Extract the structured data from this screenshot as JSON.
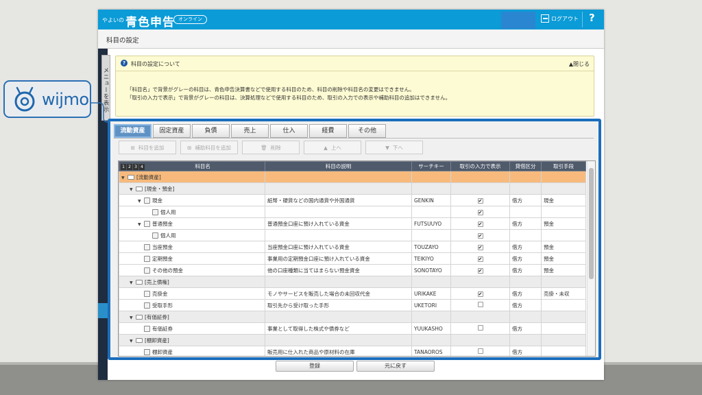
{
  "header": {
    "brand_small": "やよいの",
    "brand": "青色申告",
    "online_badge": "オンライン",
    "logout": "ログアウト",
    "help": "?"
  },
  "page_title": "科目の設定",
  "menu_tab": "メニューを表示",
  "info": {
    "title": "科目の設定について",
    "close": "▲閉じる",
    "line1": "「科目名」で背景がグレーの科目は、青色申告決算書などで使用する科目のため、科目の削除や科目名の変更はできません。",
    "line2": "「取引の入力で表示」で背景がグレーの科目は、決算処理などで使用する科目のため、取引の入力での表示や補助科目の追加はできません。"
  },
  "tabs": [
    "流動資産",
    "固定資産",
    "負債",
    "売上",
    "仕入",
    "経費",
    "その他"
  ],
  "toolbar": {
    "add_account": "科目を追加",
    "add_sub_account": "補助科目を追加",
    "delete": "削除",
    "up": "上へ",
    "down": "下へ"
  },
  "grid": {
    "levels": [
      "1",
      "2",
      "3",
      "4"
    ],
    "columns": {
      "name": "科目名",
      "description": "科目の説明",
      "search_key": "サーチキー",
      "show_in_entry": "取引の入力で表示",
      "debit_credit": "貸借区分",
      "method": "取引手段"
    },
    "rows": [
      {
        "level": 0,
        "type": "group",
        "name": "[流動資産]",
        "desc": "",
        "key": "",
        "check": "",
        "dc": "",
        "method": "",
        "selected": true
      },
      {
        "level": 1,
        "type": "group",
        "name": "[現金・預金]",
        "desc": "",
        "key": "",
        "check": "",
        "dc": "",
        "method": ""
      },
      {
        "level": 2,
        "type": "account",
        "name": "現金",
        "desc": "紙幣・硬貨などの国内通貨や外国通貨",
        "key": "GENKIN",
        "check": "on",
        "dc": "借方",
        "method": "現金"
      },
      {
        "level": 3,
        "type": "sub",
        "name": "個人用",
        "desc": "",
        "key": "",
        "check": "on",
        "dc": "",
        "method": ""
      },
      {
        "level": 2,
        "type": "account",
        "name": "普通預金",
        "desc": "普通預金口座に預け入れている資金",
        "key": "FUTSUUYO",
        "check": "on",
        "dc": "借方",
        "method": "預金"
      },
      {
        "level": 3,
        "type": "sub",
        "name": "個人用",
        "desc": "",
        "key": "",
        "check": "on",
        "dc": "",
        "method": ""
      },
      {
        "level": 2,
        "type": "leaf",
        "name": "当座預金",
        "desc": "当座預金口座に預け入れている資金",
        "key": "TOUZAYO",
        "check": "on",
        "dc": "借方",
        "method": "預金"
      },
      {
        "level": 2,
        "type": "leaf",
        "name": "定期預金",
        "desc": "事業用の定期預金口座に預け入れている資金",
        "key": "TEIKIYO",
        "check": "on",
        "dc": "借方",
        "method": "預金"
      },
      {
        "level": 2,
        "type": "leaf",
        "name": "その他の預金",
        "desc": "他の口座種類に当てはまらない預金資金",
        "key": "SONOTAYO",
        "check": "on",
        "dc": "借方",
        "method": "預金"
      },
      {
        "level": 1,
        "type": "group",
        "name": "[売上債権]",
        "desc": "",
        "key": "",
        "check": "",
        "dc": "",
        "method": ""
      },
      {
        "level": 2,
        "type": "leaf",
        "name": "売掛金",
        "desc": "モノやサービスを販売した場合の未回収代金",
        "key": "URIKAKE",
        "check": "on",
        "dc": "借方",
        "method": "売掛・未収"
      },
      {
        "level": 2,
        "type": "leaf",
        "name": "受取手形",
        "desc": "取引先から受け取った手形",
        "key": "UKETORI",
        "check": "off",
        "dc": "借方",
        "method": ""
      },
      {
        "level": 1,
        "type": "group",
        "name": "[有価証券]",
        "desc": "",
        "key": "",
        "check": "",
        "dc": "",
        "method": ""
      },
      {
        "level": 2,
        "type": "leaf",
        "name": "有価証券",
        "desc": "事業として取得した株式や債券など",
        "key": "YUUKASHO",
        "check": "off",
        "dc": "借方",
        "method": ""
      },
      {
        "level": 1,
        "type": "group",
        "name": "[棚卸資産]",
        "desc": "",
        "key": "",
        "check": "",
        "dc": "",
        "method": ""
      },
      {
        "level": 2,
        "type": "leaf",
        "name": "棚卸資産",
        "desc": "販売用に仕入れた商品や原材料の在庫",
        "key": "TANAOROS",
        "check": "off",
        "dc": "借方",
        "method": ""
      }
    ]
  },
  "bottom": {
    "register": "登録",
    "revert": "元に戻す"
  },
  "wijmo": {
    "text": "wijmo"
  }
}
